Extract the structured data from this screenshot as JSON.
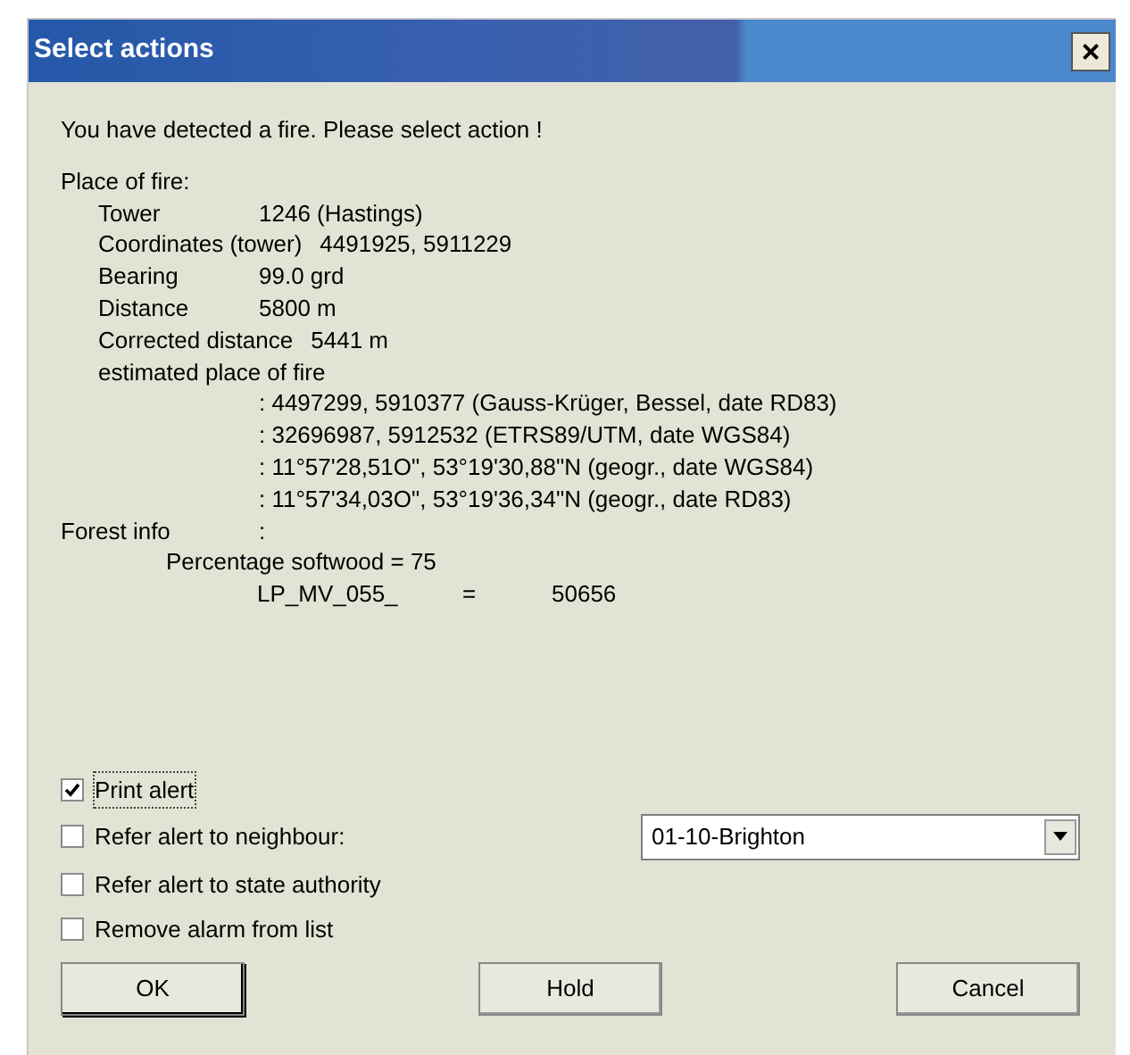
{
  "window": {
    "title": "Select actions",
    "close": "×"
  },
  "message": "You have detected a fire. Please select action !",
  "place_of_fire": {
    "heading": "Place of fire:",
    "rows": [
      {
        "label": "Tower",
        "value": "1246 (Hastings)"
      },
      {
        "label": "Coordinates (tower)",
        "value": "4491925, 5911229"
      },
      {
        "label": "Bearing",
        "value": "99.0 grd"
      },
      {
        "label": "Distance",
        "value": "5800 m"
      },
      {
        "label": "Corrected distance",
        "value": "5441 m"
      }
    ],
    "estimated_label": "estimated place of fire",
    "estimated": [
      ": 4497299, 5910377 (Gauss-Krüger, Bessel, date RD83)",
      ": 32696987, 5912532 (ETRS89/UTM, date WGS84)",
      ": 11°57'28,51O\", 53°19'30,88\"N (geogr., date WGS84)",
      ": 11°57'34,03O\", 53°19'36,34\"N (geogr., date RD83)"
    ]
  },
  "forest_info": {
    "label": "Forest info",
    "colon": ":",
    "percentage": "Percentage softwood = 75",
    "key": "LP_MV_055_",
    "equals": "=",
    "value": "50656"
  },
  "options": [
    {
      "label": "Print alert",
      "checked": true,
      "focused": true
    },
    {
      "label": "Refer alert to neighbour:",
      "checked": false,
      "focused": false,
      "dropdown": "01-10-Brighton"
    },
    {
      "label": "Refer alert to state authority",
      "checked": false,
      "focused": false
    },
    {
      "label": "Remove alarm from list",
      "checked": false,
      "focused": false
    }
  ],
  "buttons": [
    {
      "label": "OK",
      "default": true
    },
    {
      "label": "Hold",
      "default": false
    },
    {
      "label": "Cancel",
      "default": false
    }
  ]
}
